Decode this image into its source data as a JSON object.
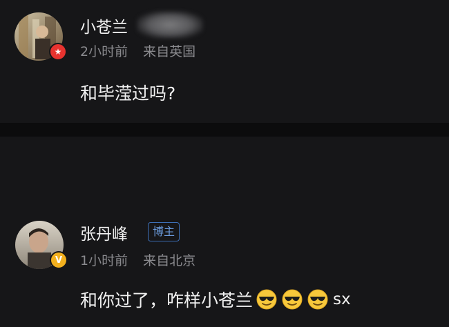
{
  "comments": [
    {
      "username": "小苍兰",
      "username_blurred": true,
      "badge": "star",
      "badge_color": "#e8332f",
      "time": "2小时前",
      "location": "来自英国",
      "text": "和毕滢过吗?"
    },
    {
      "username": "张丹峰",
      "tag": "博主",
      "badge": "V",
      "badge_color": "#f2b01e",
      "time": "1小时前",
      "location": "来自北京",
      "text": "和你过了，咋样小苍兰",
      "emojis": [
        "sunglasses-emoji",
        "sunglasses-emoji",
        "sunglasses-emoji"
      ],
      "text_suffix": "sx"
    }
  ],
  "colors": {
    "background": "#161618",
    "divider": "#0c0c0d",
    "meta_text": "#8a8a8e",
    "tag_blue": "#6b9bdc"
  }
}
